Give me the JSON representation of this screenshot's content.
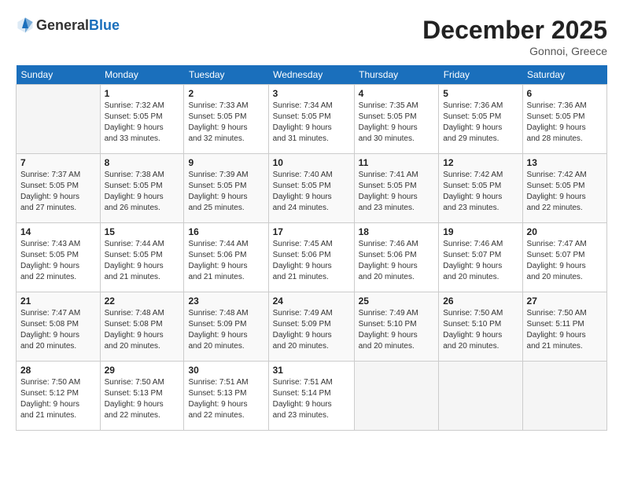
{
  "logo": {
    "general": "General",
    "blue": "Blue"
  },
  "header": {
    "month": "December 2025",
    "location": "Gonnoi, Greece"
  },
  "days_of_week": [
    "Sunday",
    "Monday",
    "Tuesday",
    "Wednesday",
    "Thursday",
    "Friday",
    "Saturday"
  ],
  "weeks": [
    [
      {
        "day": "",
        "info": ""
      },
      {
        "day": "1",
        "info": "Sunrise: 7:32 AM\nSunset: 5:05 PM\nDaylight: 9 hours\nand 33 minutes."
      },
      {
        "day": "2",
        "info": "Sunrise: 7:33 AM\nSunset: 5:05 PM\nDaylight: 9 hours\nand 32 minutes."
      },
      {
        "day": "3",
        "info": "Sunrise: 7:34 AM\nSunset: 5:05 PM\nDaylight: 9 hours\nand 31 minutes."
      },
      {
        "day": "4",
        "info": "Sunrise: 7:35 AM\nSunset: 5:05 PM\nDaylight: 9 hours\nand 30 minutes."
      },
      {
        "day": "5",
        "info": "Sunrise: 7:36 AM\nSunset: 5:05 PM\nDaylight: 9 hours\nand 29 minutes."
      },
      {
        "day": "6",
        "info": "Sunrise: 7:36 AM\nSunset: 5:05 PM\nDaylight: 9 hours\nand 28 minutes."
      }
    ],
    [
      {
        "day": "7",
        "info": "Sunrise: 7:37 AM\nSunset: 5:05 PM\nDaylight: 9 hours\nand 27 minutes."
      },
      {
        "day": "8",
        "info": "Sunrise: 7:38 AM\nSunset: 5:05 PM\nDaylight: 9 hours\nand 26 minutes."
      },
      {
        "day": "9",
        "info": "Sunrise: 7:39 AM\nSunset: 5:05 PM\nDaylight: 9 hours\nand 25 minutes."
      },
      {
        "day": "10",
        "info": "Sunrise: 7:40 AM\nSunset: 5:05 PM\nDaylight: 9 hours\nand 24 minutes."
      },
      {
        "day": "11",
        "info": "Sunrise: 7:41 AM\nSunset: 5:05 PM\nDaylight: 9 hours\nand 23 minutes."
      },
      {
        "day": "12",
        "info": "Sunrise: 7:42 AM\nSunset: 5:05 PM\nDaylight: 9 hours\nand 23 minutes."
      },
      {
        "day": "13",
        "info": "Sunrise: 7:42 AM\nSunset: 5:05 PM\nDaylight: 9 hours\nand 22 minutes."
      }
    ],
    [
      {
        "day": "14",
        "info": "Sunrise: 7:43 AM\nSunset: 5:05 PM\nDaylight: 9 hours\nand 22 minutes."
      },
      {
        "day": "15",
        "info": "Sunrise: 7:44 AM\nSunset: 5:05 PM\nDaylight: 9 hours\nand 21 minutes."
      },
      {
        "day": "16",
        "info": "Sunrise: 7:44 AM\nSunset: 5:06 PM\nDaylight: 9 hours\nand 21 minutes."
      },
      {
        "day": "17",
        "info": "Sunrise: 7:45 AM\nSunset: 5:06 PM\nDaylight: 9 hours\nand 21 minutes."
      },
      {
        "day": "18",
        "info": "Sunrise: 7:46 AM\nSunset: 5:06 PM\nDaylight: 9 hours\nand 20 minutes."
      },
      {
        "day": "19",
        "info": "Sunrise: 7:46 AM\nSunset: 5:07 PM\nDaylight: 9 hours\nand 20 minutes."
      },
      {
        "day": "20",
        "info": "Sunrise: 7:47 AM\nSunset: 5:07 PM\nDaylight: 9 hours\nand 20 minutes."
      }
    ],
    [
      {
        "day": "21",
        "info": "Sunrise: 7:47 AM\nSunset: 5:08 PM\nDaylight: 9 hours\nand 20 minutes."
      },
      {
        "day": "22",
        "info": "Sunrise: 7:48 AM\nSunset: 5:08 PM\nDaylight: 9 hours\nand 20 minutes."
      },
      {
        "day": "23",
        "info": "Sunrise: 7:48 AM\nSunset: 5:09 PM\nDaylight: 9 hours\nand 20 minutes."
      },
      {
        "day": "24",
        "info": "Sunrise: 7:49 AM\nSunset: 5:09 PM\nDaylight: 9 hours\nand 20 minutes."
      },
      {
        "day": "25",
        "info": "Sunrise: 7:49 AM\nSunset: 5:10 PM\nDaylight: 9 hours\nand 20 minutes."
      },
      {
        "day": "26",
        "info": "Sunrise: 7:50 AM\nSunset: 5:10 PM\nDaylight: 9 hours\nand 20 minutes."
      },
      {
        "day": "27",
        "info": "Sunrise: 7:50 AM\nSunset: 5:11 PM\nDaylight: 9 hours\nand 21 minutes."
      }
    ],
    [
      {
        "day": "28",
        "info": "Sunrise: 7:50 AM\nSunset: 5:12 PM\nDaylight: 9 hours\nand 21 minutes."
      },
      {
        "day": "29",
        "info": "Sunrise: 7:50 AM\nSunset: 5:13 PM\nDaylight: 9 hours\nand 22 minutes."
      },
      {
        "day": "30",
        "info": "Sunrise: 7:51 AM\nSunset: 5:13 PM\nDaylight: 9 hours\nand 22 minutes."
      },
      {
        "day": "31",
        "info": "Sunrise: 7:51 AM\nSunset: 5:14 PM\nDaylight: 9 hours\nand 23 minutes."
      },
      {
        "day": "",
        "info": ""
      },
      {
        "day": "",
        "info": ""
      },
      {
        "day": "",
        "info": ""
      }
    ]
  ]
}
